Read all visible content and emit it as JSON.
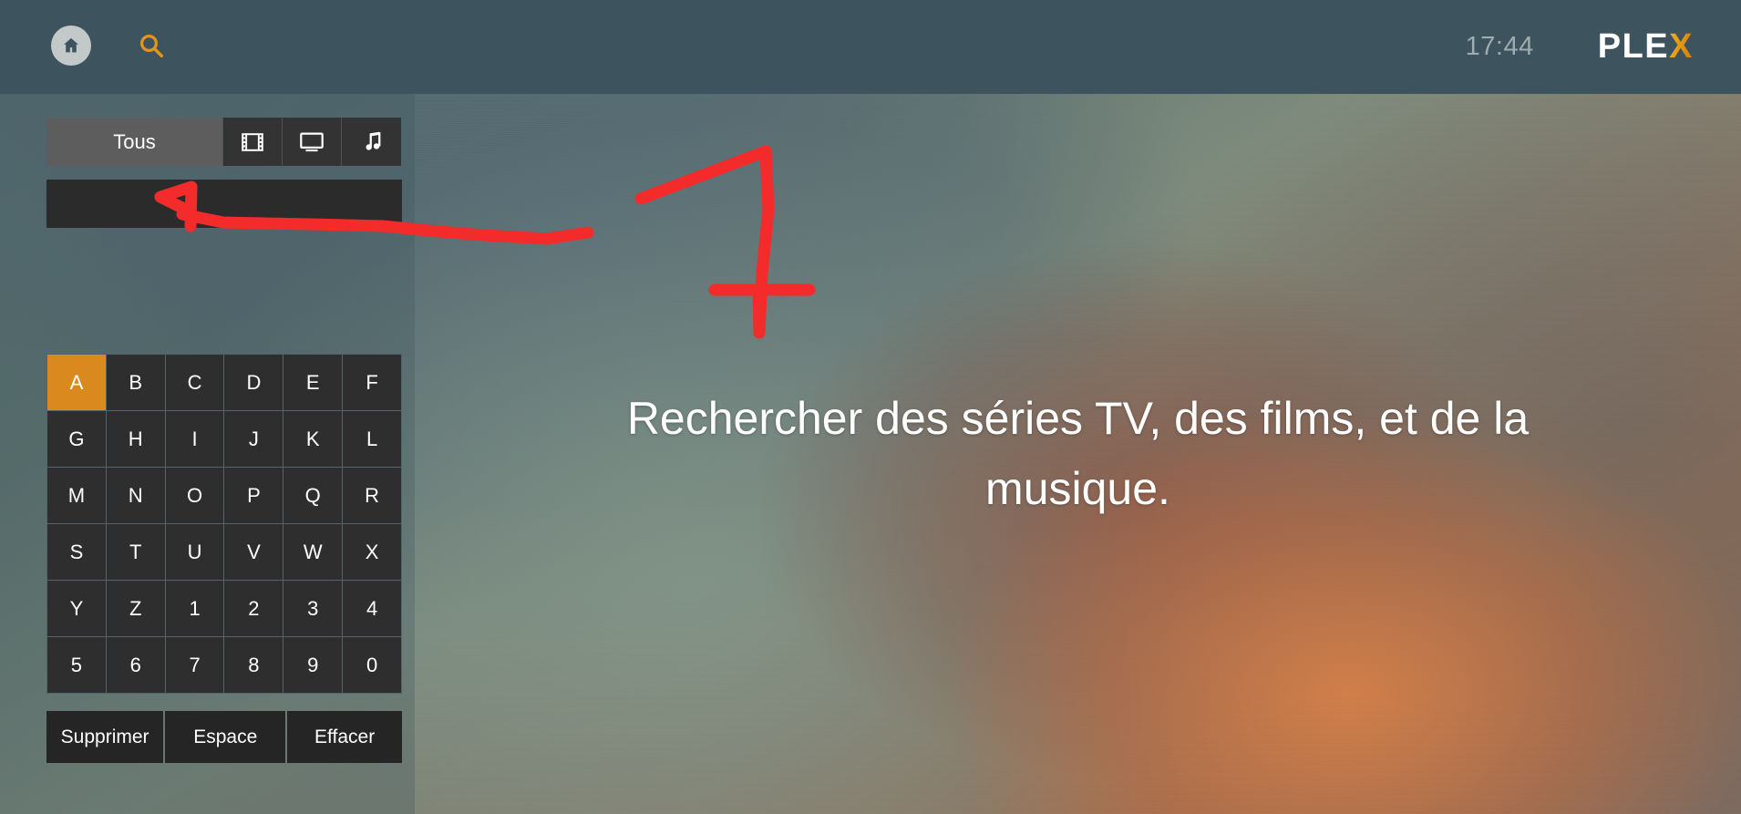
{
  "header": {
    "home_icon": "home-icon",
    "search_icon": "search-icon",
    "clock": "17:44",
    "logo_main": "PLE",
    "logo_accent": "X",
    "bar_color": "#3d535e"
  },
  "sidebar": {
    "tabs": [
      {
        "label": "Tous",
        "icon": "",
        "selected": true
      },
      {
        "label": "",
        "icon": "film-strip-icon",
        "selected": false
      },
      {
        "label": "",
        "icon": "tv-monitor-icon",
        "selected": false
      },
      {
        "label": "",
        "icon": "music-note-icon",
        "selected": false
      }
    ],
    "search_input": {
      "value": "",
      "placeholder": ""
    },
    "keyboard": {
      "keys": [
        "A",
        "B",
        "C",
        "D",
        "E",
        "F",
        "G",
        "H",
        "I",
        "J",
        "K",
        "L",
        "M",
        "N",
        "O",
        "P",
        "Q",
        "R",
        "S",
        "T",
        "U",
        "V",
        "W",
        "X",
        "Y",
        "Z",
        "1",
        "2",
        "3",
        "4",
        "5",
        "6",
        "7",
        "8",
        "9",
        "0"
      ],
      "selected_key": "A",
      "selected_color": "#d9891e",
      "key_color": "#2e2e2e"
    },
    "actions": [
      {
        "label": "Supprimer"
      },
      {
        "label": "Espace"
      },
      {
        "label": "Effacer"
      }
    ]
  },
  "main": {
    "prompt": "Rechercher des séries TV, des films, et de la musique."
  },
  "annotation": {
    "color": "#f42b2b",
    "numeral": "1",
    "arrow": "left-pointing-arrow-to-search-field"
  }
}
